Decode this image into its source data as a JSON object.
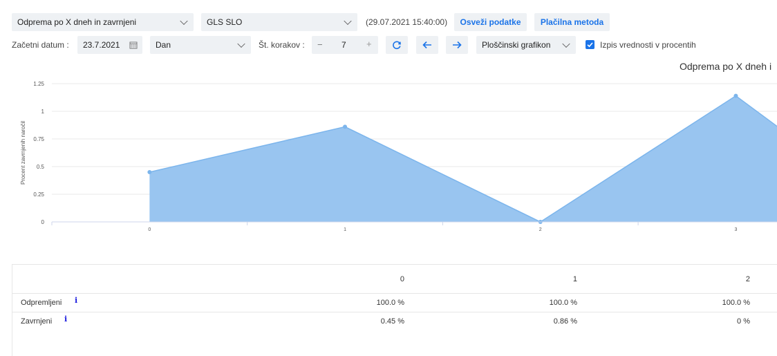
{
  "toolbar": {
    "report_select": "Odprema po X dneh in zavrnjeni",
    "carrier_select": "GLS SLO",
    "timestamp": "(29.07.2021 15:40:00)",
    "refresh_label": "Osveži podatke",
    "payment_label": "Plačilna metoda",
    "start_date_label": "Začetni datum :",
    "start_date_value": "23.7.2021",
    "period_select": "Dan",
    "steps_label": "Št. korakov :",
    "steps_value": "7",
    "steps_minus": "−",
    "steps_plus": "+",
    "chart_type_select": "Ploščinski grafikon",
    "percent_checkbox_label": "Izpis vrednosti v procentih",
    "percent_checked": true
  },
  "chart_data": {
    "type": "area",
    "title": "Odprema po X dneh i",
    "ylabel": "Procent zavrnjenih naročil",
    "xlabel": "",
    "x": [
      "0",
      "1",
      "2",
      "3"
    ],
    "values": [
      0.45,
      0.86,
      0,
      1.14
    ],
    "yticks": [
      "0",
      "0.25",
      "0.5",
      "0.75",
      "1",
      "1.25"
    ],
    "ylim": [
      0,
      1.25
    ],
    "grid": true,
    "color": "#99c5f0",
    "line_color": "#7cb5ec"
  },
  "table": {
    "columns": [
      "0",
      "1",
      "2"
    ],
    "rows": [
      {
        "label": "Odpremljeni",
        "info": "i",
        "values": [
          "100.0 %",
          "100.0 %",
          "100.0 %"
        ]
      },
      {
        "label": "Zavrnjeni",
        "info": "i",
        "values": [
          "0.45 %",
          "0.86 %",
          "0 %"
        ]
      }
    ]
  }
}
